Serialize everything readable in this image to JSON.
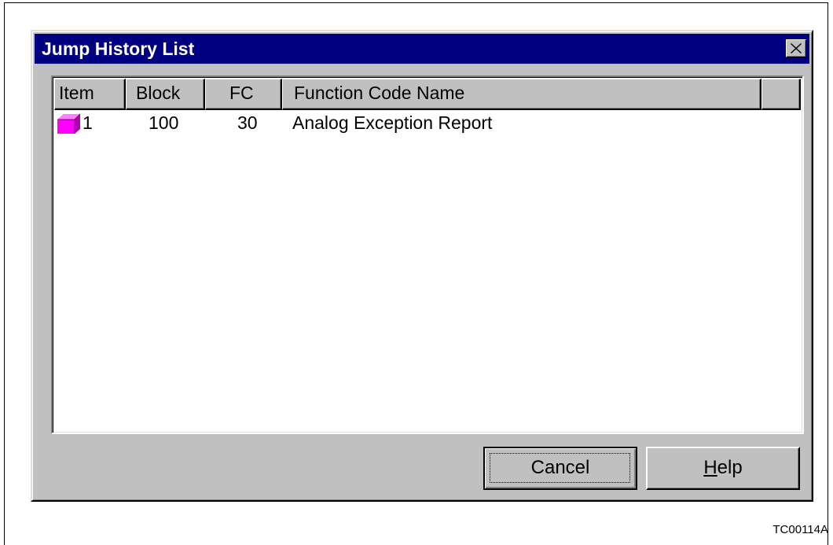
{
  "dialog": {
    "title": "Jump History List",
    "close_label": "×"
  },
  "list": {
    "columns": [
      "Item",
      "Block",
      "FC",
      "Function Code Name",
      ""
    ],
    "rows": [
      {
        "icon": "block-icon",
        "item": "1",
        "block": "100",
        "fc": "30",
        "name": "Analog Exception Report"
      }
    ]
  },
  "buttons": {
    "cancel": "Cancel",
    "help_mnemonic": "H",
    "help_rest": "elp"
  },
  "figure_id": "TC00114A",
  "colors": {
    "titlebar": "#000080",
    "face": "#c0c0c0",
    "icon": "#ff00ff"
  }
}
